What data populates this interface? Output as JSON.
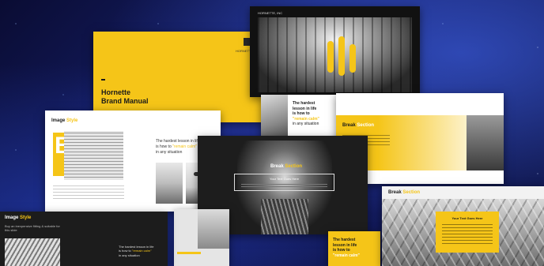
{
  "yellow_slide": {
    "brand_line1": "Hornette",
    "brand_line1_accent": "",
    "brand_line2": "Brand Manual",
    "brand_mark": "HORNETTE"
  },
  "dark_top": {
    "label": "HORNETTE, INC"
  },
  "image_style_slide": {
    "title": "Image",
    "title_accent": "Style",
    "letter": "B",
    "quote_line1": "The hardest lesson in life",
    "quote_line2": "is how to",
    "quote_highlight": "\"remain calm\"",
    "quote_line3": "in any situation"
  },
  "mid_quote_slide": {
    "line1": "The hardest",
    "line2": "lesson in life",
    "line3": "is how to",
    "highlight": "\"remain calm\"",
    "line4": "in any situation"
  },
  "break_section_right": {
    "title": "Break",
    "title_accent": "Section"
  },
  "center_dark": {
    "title": "Break",
    "title_accent": "Section",
    "box_heading": "Your Text Goes Here"
  },
  "bottom_left": {
    "title": "Image",
    "title_accent": "Style",
    "subtitle": "Buy an inexpensive fitting & suitable for this slide",
    "quote_line1": "The hardest lesson in life",
    "quote_line2": "is how to",
    "quote_highlight": "\"remain calm\"",
    "quote_line3": "in any situation"
  },
  "bottom_yellow": {
    "line1": "The hardest",
    "line2": "lesson in life",
    "line3": "is how to",
    "highlight": "\"remain calm\""
  },
  "bottom_right": {
    "title": "Break",
    "title_accent": "Section",
    "box_heading": "Your Text Goes Here"
  },
  "colors": {
    "accent": "#f5c518",
    "dark": "#1a1a1a",
    "background": "#0b0f3a"
  }
}
